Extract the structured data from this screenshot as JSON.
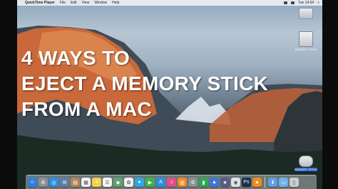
{
  "menubar": {
    "app_name": "QuickTime Player",
    "menus": [
      "File",
      "Edit",
      "View",
      "Window",
      "Help"
    ],
    "clock": "Tue 14:54"
  },
  "desktop": {
    "icons": [
      {
        "label": ""
      },
      {
        "label": "MEMORY STICK"
      },
      {
        "label": "MEMORY STICK"
      }
    ]
  },
  "headline": {
    "line1": "4 WAYS TO",
    "line2": "EJECT A MEMORY STICK",
    "line3": "FROM A MAC"
  },
  "dock": {
    "icons": [
      {
        "name": "finder-icon",
        "color": "#2f7fe0",
        "glyph": "☺"
      },
      {
        "name": "launchpad-icon",
        "color": "#8a8f97",
        "glyph": "⚙"
      },
      {
        "name": "safari-icon",
        "color": "#2e8ee6",
        "glyph": "◎"
      },
      {
        "name": "mail-icon",
        "color": "#5c7ea8",
        "glyph": "✉"
      },
      {
        "name": "contacts-icon",
        "color": "#b0875a",
        "glyph": "▤"
      },
      {
        "name": "calendar-icon",
        "color": "#f2f2f2",
        "glyph": "▦"
      },
      {
        "name": "notes-icon",
        "color": "#f4d24a",
        "glyph": "≡"
      },
      {
        "name": "reminders-icon",
        "color": "#f5f5f5",
        "glyph": "☰"
      },
      {
        "name": "maps-icon",
        "color": "#5aa86a",
        "glyph": "◆"
      },
      {
        "name": "photos-icon",
        "color": "#f0f0f0",
        "glyph": "✿"
      },
      {
        "name": "messages-icon",
        "color": "#2fa7e8",
        "glyph": "●"
      },
      {
        "name": "facetime-icon",
        "color": "#39b54a",
        "glyph": "▶"
      },
      {
        "name": "app-store-icon",
        "color": "#2a8de6",
        "glyph": "A"
      },
      {
        "name": "itunes-icon",
        "color": "#e54a8a",
        "glyph": "♫"
      },
      {
        "name": "ibooks-icon",
        "color": "#f08a24",
        "glyph": "▥"
      },
      {
        "name": "system-preferences-icon",
        "color": "#8c8f94",
        "glyph": "⚙"
      },
      {
        "name": "numbers-icon",
        "color": "#2ea84f",
        "glyph": "▮"
      },
      {
        "name": "keynote-icon",
        "color": "#3a78d8",
        "glyph": "▲"
      },
      {
        "name": "imovie-icon",
        "color": "#5a5a8a",
        "glyph": "★"
      },
      {
        "name": "chrome-icon",
        "color": "#dfe4e8",
        "glyph": "◉"
      },
      {
        "name": "photoshop-icon",
        "color": "#1a2f4a",
        "glyph": "Ps"
      },
      {
        "name": "vlc-icon",
        "color": "#f08c1c",
        "glyph": "▲"
      },
      {
        "name": "downloads-icon",
        "color": "#5e9fe0",
        "glyph": "⬇"
      },
      {
        "name": "folder-icon",
        "color": "#6fb0ea",
        "glyph": "▭"
      },
      {
        "name": "trash-icon",
        "color": "#c9cdd2",
        "glyph": "▯"
      }
    ]
  }
}
